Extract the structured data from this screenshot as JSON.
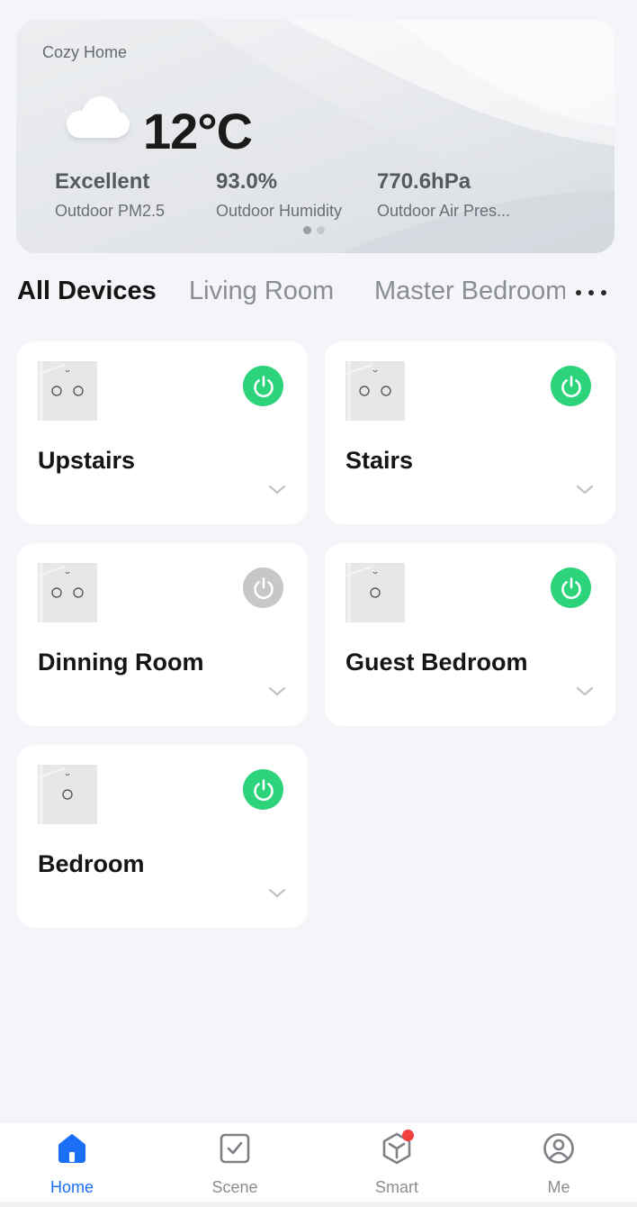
{
  "weather": {
    "home_name": "Cozy Home",
    "icon": "cloud-icon",
    "temperature": "12°C",
    "stats": [
      {
        "value": "Excellent",
        "label": "Outdoor PM2.5"
      },
      {
        "value": "93.0%",
        "label": "Outdoor Humidity"
      },
      {
        "value": "770.6hPa",
        "label": "Outdoor Air Pres..."
      }
    ],
    "page_count": 2,
    "active_page": 1
  },
  "tabs": {
    "items": [
      "All Devices",
      "Living Room",
      "Master Bedroom"
    ],
    "active": "All Devices",
    "more_icon": "more-dots-icon"
  },
  "devices": [
    {
      "name": "Upstairs",
      "power": "on",
      "switch_count": 2
    },
    {
      "name": "Stairs",
      "power": "on",
      "switch_count": 2
    },
    {
      "name": "Dinning Room",
      "power": "off",
      "switch_count": 2
    },
    {
      "name": "Guest Bedroom",
      "power": "on",
      "switch_count": 1
    },
    {
      "name": "Bedroom",
      "power": "on",
      "switch_count": 1
    }
  ],
  "colors": {
    "power_on": "#2cd37a",
    "power_off": "#c7c7c7",
    "accent": "#1a6ff5",
    "badge": "#f2403d"
  },
  "nav": {
    "items": [
      {
        "label": "Home",
        "icon": "home-icon",
        "active": true
      },
      {
        "label": "Scene",
        "icon": "scene-checkbox-icon",
        "active": false
      },
      {
        "label": "Smart",
        "icon": "smart-cube-icon",
        "active": false,
        "badge": true
      },
      {
        "label": "Me",
        "icon": "profile-icon",
        "active": false
      }
    ]
  }
}
